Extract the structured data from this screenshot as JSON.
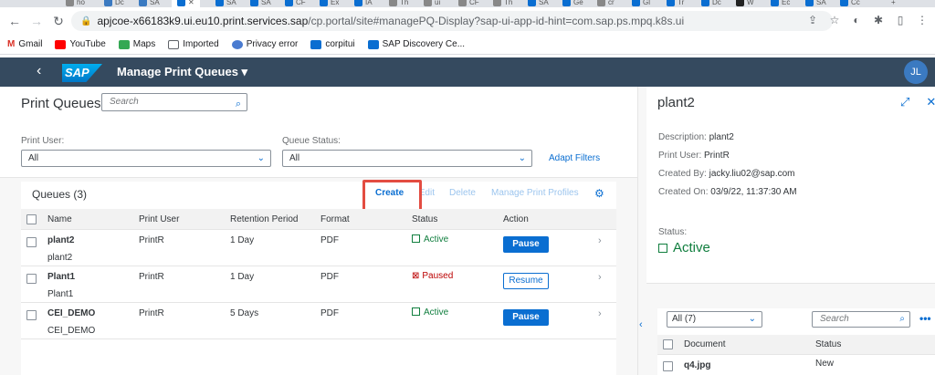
{
  "browser": {
    "active_tab_icon": "sap-icon",
    "url_domain": "apjcoe-x66183k9.ui.eu10.print.services.sap",
    "url_rest": "/cp.portal/site#managePQ-Display?sap-ui-app-id-hint=com.sap.ps.mpq.k8s.ui",
    "bookmarks": [
      "Gmail",
      "YouTube",
      "Maps",
      "Imported",
      "Privacy error",
      "corpitui",
      "SAP Discovery Ce..."
    ],
    "tabs": [
      "ho",
      "Dc",
      "SA",
      "SA",
      "SA",
      "CF",
      "Ex",
      "IA",
      "Th",
      "ui",
      "CF",
      "Th",
      "SA",
      "Ge",
      "cr",
      "Gl",
      "Tr",
      "Dc",
      "W",
      "Ec",
      "SA",
      "Cc"
    ]
  },
  "shell": {
    "logo": "SAP",
    "title": "Manage Print Queues ▾",
    "avatar": "JL"
  },
  "page": {
    "title": "Print Queues",
    "search_placeholder": "Search",
    "filters": {
      "print_user_label": "Print User:",
      "print_user_value": "All",
      "queue_status_label": "Queue Status:",
      "queue_status_value": "All",
      "adapt_filters": "Adapt Filters"
    },
    "queues_title": "Queues (3)",
    "toolbar": {
      "create": "Create",
      "edit": "Edit",
      "delete": "Delete",
      "manage_profiles": "Manage Print Profiles"
    },
    "columns": [
      "Name",
      "Print User",
      "Retention Period",
      "Format",
      "Status",
      "Action"
    ],
    "rows": [
      {
        "name": "plant2",
        "desc": "plant2",
        "user": "PrintR",
        "retention": "1 Day",
        "format": "PDF",
        "status": "Active",
        "action": "Pause"
      },
      {
        "name": "Plant1",
        "desc": "Plant1",
        "user": "PrintR",
        "retention": "1 Day",
        "format": "PDF",
        "status": "Paused",
        "action": "Resume"
      },
      {
        "name": "CEI_DEMO",
        "desc": "CEI_DEMO",
        "user": "PrintR",
        "retention": "5 Days",
        "format": "PDF",
        "status": "Active",
        "action": "Pause"
      }
    ]
  },
  "detail": {
    "title": "plant2",
    "description_label": "Description:",
    "description": "plant2",
    "print_user_label": "Print User:",
    "print_user": "PrintR",
    "created_by_label": "Created By:",
    "created_by": "jacky.liu02@sap.com",
    "created_on_label": "Created On:",
    "created_on": "03/9/22, 11:37:30 AM",
    "status_label": "Status:",
    "status": "Active",
    "docs": {
      "filter": "All (7)",
      "search_placeholder": "Search",
      "col_document": "Document",
      "col_status": "Status",
      "row_document": "q4.jpg",
      "row_status": "New"
    }
  },
  "colors": {
    "shell_bg": "#354a5f",
    "accent": "#0a6ed1",
    "success": "#107e3e",
    "error": "#bb0000",
    "highlight": "#e34c41"
  }
}
